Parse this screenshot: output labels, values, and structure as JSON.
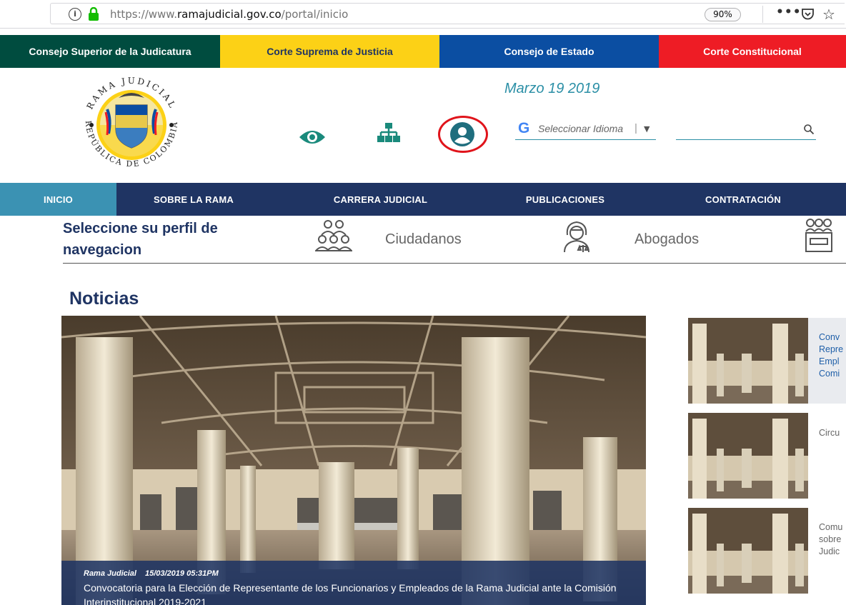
{
  "browser": {
    "url_prefix": "https://www.",
    "url_domain": "ramajudicial.gov.co",
    "url_path": "/portal/inicio",
    "zoom": "90%",
    "info_glyph": "i",
    "menu_glyph": "•••",
    "star_glyph": "☆"
  },
  "courts": [
    {
      "label": "Consejo Superior de la Judicatura",
      "color": "#004c3f"
    },
    {
      "label": "Corte Suprema de Justicia",
      "color": "#fcd116"
    },
    {
      "label": "Consejo de Estado",
      "color": "#0b4ea2"
    },
    {
      "label": "Corte Constitucional",
      "color": "#ee1c25"
    }
  ],
  "header": {
    "date": "Marzo 19 2019",
    "language": {
      "g_letter": "G",
      "label": "Seleccionar Idioma",
      "separator": "|",
      "caret": "▼"
    },
    "search_placeholder": ""
  },
  "logo": {
    "top_text": "RAMA JUDICIAL",
    "bottom_text": "REPÚBLICA DE COLOMBIA"
  },
  "nav": [
    {
      "label": "INICIO",
      "active": true
    },
    {
      "label": "SOBRE LA RAMA",
      "active": false
    },
    {
      "label": "CARRERA JUDICIAL",
      "active": false
    },
    {
      "label": "PUBLICACIONES",
      "active": false
    },
    {
      "label": "CONTRATACIÓN",
      "active": false
    }
  ],
  "profile": {
    "title": "Seleccione su perfil de navegacion",
    "options": [
      {
        "label": "Ciudadanos",
        "icon": "citizens-icon"
      },
      {
        "label": "Abogados",
        "icon": "lawyer-icon"
      },
      {
        "label": "",
        "icon": "officials-icon"
      }
    ]
  },
  "news": {
    "title": "Noticias",
    "featured": {
      "author": "Rama Judicial",
      "datetime": "15/03/2019 05:31PM",
      "headline": "Convocatoria para la Elección de Representante de los Funcionarios y Empleados de la Rama Judicial ante la Comisión Interinstitucional 2019-2021"
    },
    "side": [
      {
        "lines": [
          "Conv",
          "Repre",
          "Empl",
          "Comi"
        ],
        "highlight": true
      },
      {
        "lines": [
          "Circu"
        ],
        "highlight": false
      },
      {
        "lines": [
          "Comu",
          "sobre",
          "Judic"
        ],
        "highlight": false
      }
    ]
  },
  "colors": {
    "navy": "#1f3463",
    "teal": "#3b92b3",
    "highlight": "#e0141b"
  }
}
